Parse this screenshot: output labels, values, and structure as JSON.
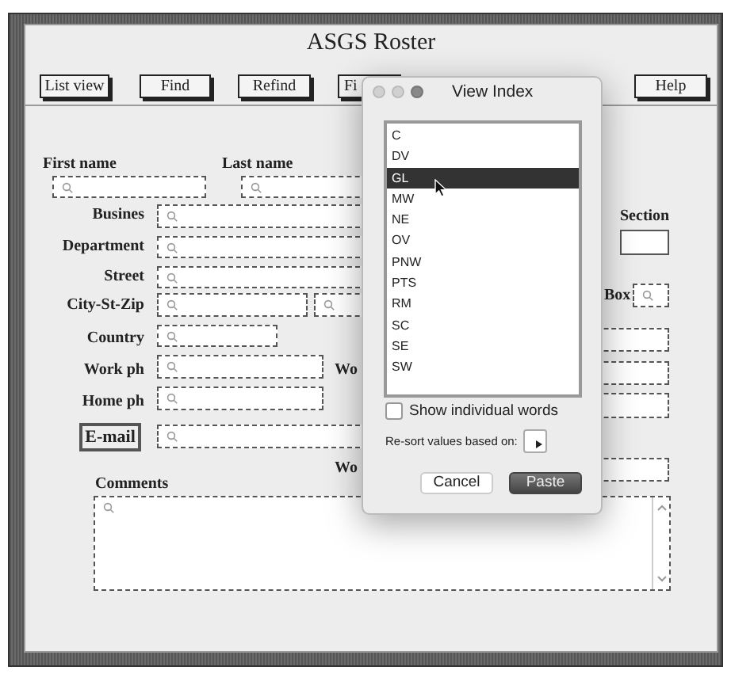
{
  "window": {
    "title": "ASGS Roster"
  },
  "toolbar": [
    {
      "label": "List view"
    },
    {
      "label": "Find"
    },
    {
      "label": "Refind"
    },
    {
      "label": "Fi"
    },
    {
      "label": "Help"
    }
  ],
  "labels": [
    {
      "text": "First name",
      "kind": "plain"
    },
    {
      "text": "Last name",
      "kind": "plain"
    },
    {
      "text": "Busines",
      "kind": "plain"
    },
    {
      "text": "Department",
      "kind": "plain"
    },
    {
      "text": "Street",
      "kind": "plain"
    },
    {
      "text": "City-St-Zip",
      "kind": "plain"
    },
    {
      "text": "Country",
      "kind": "plain"
    },
    {
      "text": "Work ph",
      "kind": "plain"
    },
    {
      "text": "Wo",
      "kind": "plain"
    },
    {
      "text": "Home ph",
      "kind": "plain"
    },
    {
      "text": "E-mail",
      "kind": "boxed"
    },
    {
      "text": "Wo",
      "kind": "plain"
    },
    {
      "text": "Comments",
      "kind": "plain"
    },
    {
      "text": "Section",
      "kind": "plain"
    },
    {
      "text": "Box",
      "kind": "plain"
    }
  ],
  "fields": [
    {
      "kind": "search"
    },
    {
      "kind": "search"
    },
    {
      "kind": "search"
    },
    {
      "kind": "search"
    },
    {
      "kind": "search"
    },
    {
      "kind": "search"
    },
    {
      "kind": "search"
    },
    {
      "kind": "search"
    },
    {
      "kind": "search"
    },
    {
      "kind": "search"
    },
    {
      "kind": "search"
    },
    {
      "kind": "plain"
    },
    {
      "kind": "search"
    },
    {
      "kind": "dashed"
    },
    {
      "kind": "dashed"
    },
    {
      "kind": "dashed"
    },
    {
      "kind": "dashed"
    },
    {
      "kind": "memo"
    }
  ],
  "dialog": {
    "title": "View Index",
    "items": [
      {
        "label": "C",
        "selected": false
      },
      {
        "label": "DV",
        "selected": false
      },
      {
        "label": "GL",
        "selected": true
      },
      {
        "label": "MW",
        "selected": false
      },
      {
        "label": "NE",
        "selected": false
      },
      {
        "label": "OV",
        "selected": false
      },
      {
        "label": "PNW",
        "selected": false
      },
      {
        "label": "PTS",
        "selected": false
      },
      {
        "label": "RM",
        "selected": false
      },
      {
        "label": "SC",
        "selected": false
      },
      {
        "label": "SE",
        "selected": false
      },
      {
        "label": "SW",
        "selected": false
      }
    ],
    "show_words": {
      "label": "Show individual words",
      "checked": false
    },
    "resort_label": "Re-sort values based on:",
    "buttons": [
      {
        "label": "Cancel",
        "kind": "secondary"
      },
      {
        "label": "Paste",
        "kind": "default"
      }
    ]
  }
}
